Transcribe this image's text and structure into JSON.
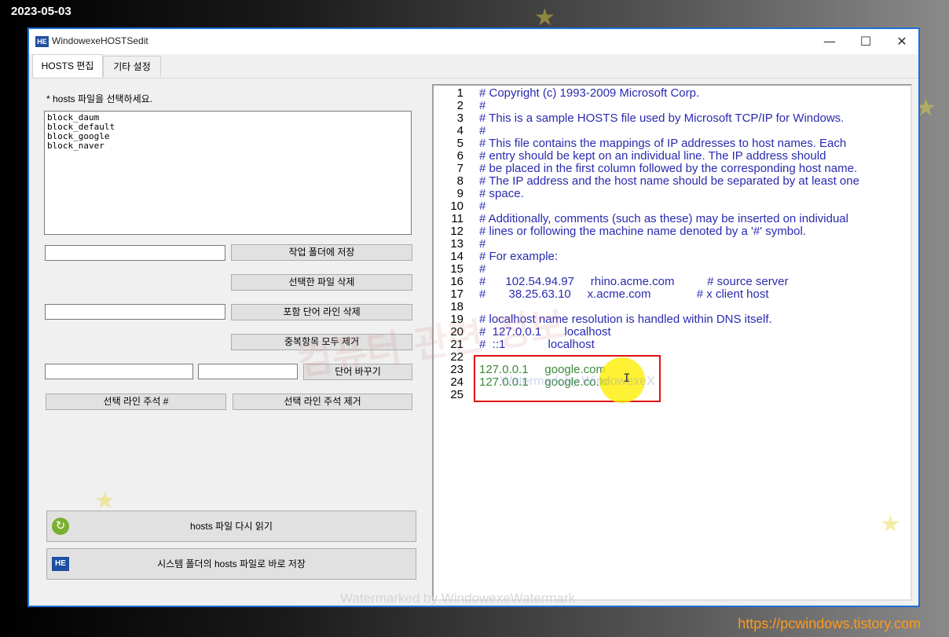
{
  "overlay": {
    "date": "2023-05-03",
    "site": "https://pcwindows.tistory.com",
    "watermark_main": "컴퓨터 관련 정보",
    "watermark_small": "Watermark by WindowexeX",
    "watermark_bottom": "Watermarked by WindowexeWatermark"
  },
  "window": {
    "title": "WindowexeHOSTSedit",
    "icon_text": "HE",
    "controls": {
      "minimize": "—",
      "maximize": "☐",
      "close": "✕"
    }
  },
  "tabs": [
    {
      "label": "HOSTS 편집",
      "active": true
    },
    {
      "label": "기타 설정",
      "active": false
    }
  ],
  "left": {
    "select_label": "* hosts 파일을 선택하세요.",
    "files": [
      "block_daum",
      "block_default",
      "block_google",
      "block_naver"
    ],
    "save_folder_input": "",
    "save_folder_button": "작업 폴더에 저장",
    "delete_file_button": "선택한 파일 삭제",
    "word_input": "",
    "delete_lines_button": "포함 단어 라인 삭제",
    "dedupe_button": "중복항목 모두 제거",
    "find_input": "",
    "replace_input": "",
    "replace_button": "단어 바꾸기",
    "comment_button": "선택 라인 주석 #",
    "uncomment_button": "선택 라인 주석 제거",
    "reload_button": "hosts 파일 다시 읽기",
    "save_system_button": "시스템 폴더의 hosts 파일로 바로 저장"
  },
  "editor": {
    "lines": [
      "# Copyright (c) 1993-2009 Microsoft Corp.",
      "#",
      "# This is a sample HOSTS file used by Microsoft TCP/IP for Windows.",
      "#",
      "# This file contains the mappings of IP addresses to host names. Each",
      "# entry should be kept on an individual line. The IP address should",
      "# be placed in the first column followed by the corresponding host name.",
      "# The IP address and the host name should be separated by at least one",
      "# space.",
      "#",
      "# Additionally, comments (such as these) may be inserted on individual",
      "# lines or following the machine name denoted by a '#' symbol.",
      "#",
      "# For example:",
      "#",
      "#      102.54.94.97     rhino.acme.com          # source server",
      "#       38.25.63.10     x.acme.com              # x client host",
      "",
      "# localhost name resolution is handled within DNS itself.",
      "#  127.0.0.1       localhost",
      "#  ::1             localhost",
      "",
      "127.0.0.1     google.com",
      "127.0.0.1     google.co.kr",
      ""
    ]
  }
}
